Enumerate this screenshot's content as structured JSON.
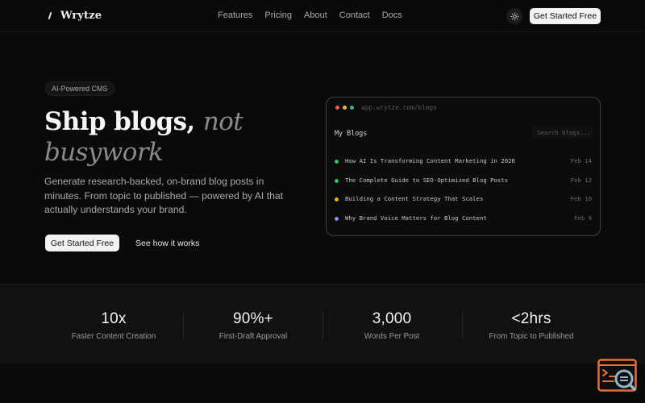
{
  "nav": {
    "brand": "Wrytze",
    "links": [
      "Features",
      "Pricing",
      "About",
      "Contact",
      "Docs"
    ],
    "cta": "Get Started Free"
  },
  "hero": {
    "badge": "AI-Powered CMS",
    "headline_strong": "Ship blogs,",
    "headline_em": "not busywork",
    "subtitle": "Generate research-backed, on-brand blog posts in minutes. From topic to published — powered by AI that actually understands your brand.",
    "primary_cta": "Get Started Free",
    "secondary_cta": "See how it works"
  },
  "mock": {
    "url": "app.wrytze.com/blogs",
    "title": "My Blogs",
    "search_placeholder": "Search blogs...",
    "posts": [
      {
        "title": "How AI Is Transforming Content Marketing in 2026",
        "date": "Feb 14",
        "status_color": "#22c55e"
      },
      {
        "title": "The Complete Guide to SEO-Optimized Blog Posts",
        "date": "Feb 12",
        "status_color": "#22c55e"
      },
      {
        "title": "Building a Content Strategy That Scales",
        "date": "Feb 10",
        "status_color": "#eab308"
      },
      {
        "title": "Why Brand Voice Matters for Blog Content",
        "date": "Feb 9",
        "status_color": "#818cf8"
      }
    ]
  },
  "stats": [
    {
      "value": "10x",
      "label": "Faster Content Creation"
    },
    {
      "value": "90%+",
      "label": "First-Draft Approval"
    },
    {
      "value": "3,000",
      "label": "Words Per Post"
    },
    {
      "value": "<2hrs",
      "label": "From Topic to Published"
    }
  ],
  "colors": {
    "background": "#0a0a0a",
    "window_dot_red": "#ef5a4f",
    "window_dot_yellow": "#f5b43c",
    "window_dot_green": "#2fbf71",
    "widget_accent": "#e0703a"
  }
}
